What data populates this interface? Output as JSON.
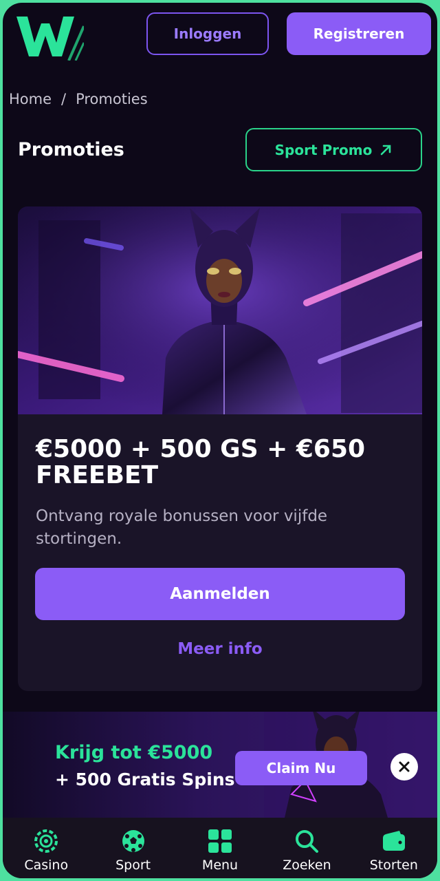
{
  "header": {
    "login_label": "Inloggen",
    "register_label": "Registreren"
  },
  "breadcrumb": {
    "home": "Home",
    "separator": "/",
    "current": "Promoties"
  },
  "page": {
    "title": "Promoties",
    "sport_promo_label": "Sport Promo"
  },
  "promo_card": {
    "title": "€5000 + 500 GS + €650 FREEBET",
    "description": "Ontvang royale bonussen voor vijfde stortingen.",
    "signup_label": "Aanmelden",
    "more_info_label": "Meer info"
  },
  "banner": {
    "line1": "Krijg tot €5000",
    "line2": "+ 500 Gratis Spins",
    "claim_label": "Claim Nu"
  },
  "bottom_nav": {
    "items": [
      {
        "label": "Casino",
        "icon": "casino-chip-icon"
      },
      {
        "label": "Sport",
        "icon": "soccer-ball-icon"
      },
      {
        "label": "Menu",
        "icon": "grid-menu-icon"
      },
      {
        "label": "Zoeken",
        "icon": "search-icon"
      },
      {
        "label": "Storten",
        "icon": "wallet-icon"
      }
    ]
  },
  "colors": {
    "accent_purple": "#8b5cf6",
    "accent_green": "#2be39a",
    "background": "#0d0818",
    "card": "#1a1428"
  }
}
